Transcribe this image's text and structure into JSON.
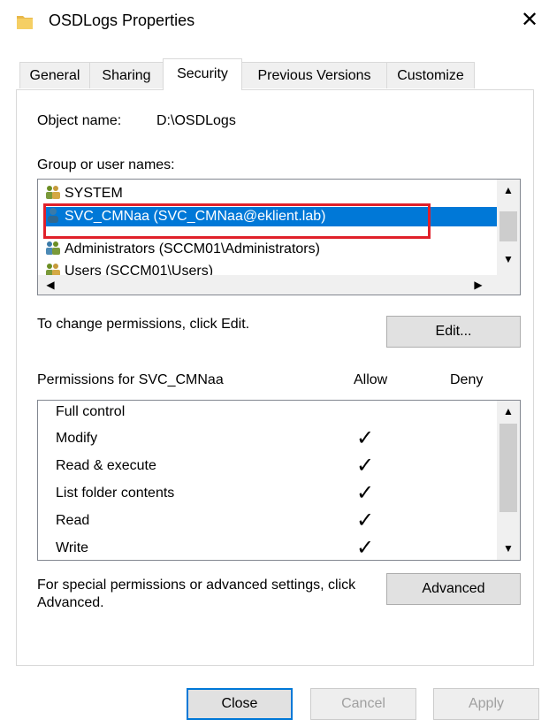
{
  "window": {
    "title": "OSDLogs Properties",
    "close_icon": "close-icon"
  },
  "tabs": [
    {
      "label": "General"
    },
    {
      "label": "Sharing"
    },
    {
      "label": "Security"
    },
    {
      "label": "Previous Versions"
    },
    {
      "label": "Customize"
    }
  ],
  "active_tab": "Security",
  "object": {
    "label": "Object name:",
    "value": "D:\\OSDLogs"
  },
  "groups": {
    "label": "Group or user names:",
    "items": [
      {
        "name": "SYSTEM",
        "selected": false
      },
      {
        "name": "SVC_CMNaa (SVC_CMNaa@eklient.lab)",
        "selected": true
      },
      {
        "name": "Administrators (SCCM01\\Administrators)",
        "selected": false
      },
      {
        "name": "Users (SCCM01\\Users)",
        "selected": false
      }
    ]
  },
  "edit": {
    "hint": "To change permissions, click Edit.",
    "button": "Edit..."
  },
  "permissions": {
    "header": "Permissions for SVC_CMNaa",
    "allow_label": "Allow",
    "deny_label": "Deny",
    "rows": [
      {
        "name": "Full control",
        "allow": false,
        "deny": false
      },
      {
        "name": "Modify",
        "allow": true,
        "deny": false
      },
      {
        "name": "Read & execute",
        "allow": true,
        "deny": false
      },
      {
        "name": "List folder contents",
        "allow": true,
        "deny": false
      },
      {
        "name": "Read",
        "allow": true,
        "deny": false
      },
      {
        "name": "Write",
        "allow": true,
        "deny": false
      }
    ],
    "check_glyph": "✓"
  },
  "advanced": {
    "hint": "For special permissions or advanced settings, click Advanced.",
    "button": "Advanced"
  },
  "footer": {
    "close": "Close",
    "cancel": "Cancel",
    "apply": "Apply"
  },
  "colors": {
    "selection": "#0078d7",
    "highlight_border": "#e0202a"
  }
}
